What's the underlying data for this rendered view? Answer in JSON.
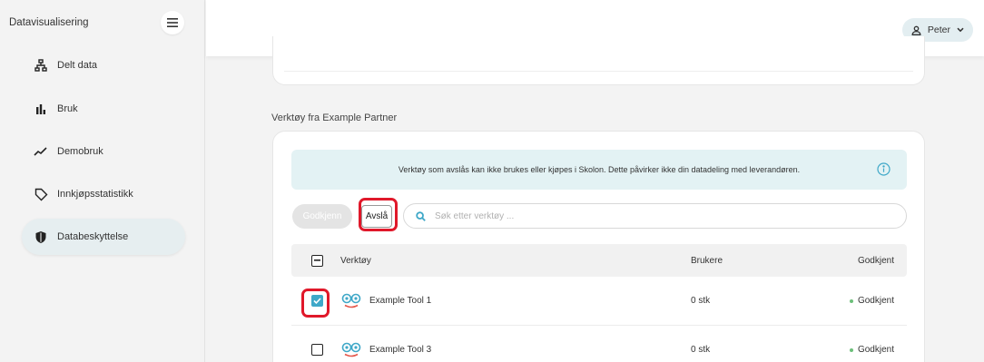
{
  "sidebar": {
    "title": "Datavisualisering",
    "items": [
      {
        "label": "Delt data",
        "icon": "sitemap-icon"
      },
      {
        "label": "Bruk",
        "icon": "bar-chart-icon"
      },
      {
        "label": "Demobruk",
        "icon": "trend-line-icon"
      },
      {
        "label": "Innkjøpsstatistikk",
        "icon": "tag-icon"
      },
      {
        "label": "Databeskyttelse",
        "icon": "shield-icon",
        "active": true
      }
    ]
  },
  "header": {
    "user_name": "Peter"
  },
  "section": {
    "title": "Verktøy fra Example Partner"
  },
  "info_banner": {
    "text": "Verktøy som avslås kan ikke brukes eller kjøpes i Skolon. Dette påvirker ikke din datadeling med leverandøren."
  },
  "actions": {
    "approve_label": "Godkjenn",
    "reject_label": "Avslå",
    "search_placeholder": "Søk etter verktøy ..."
  },
  "table": {
    "columns": {
      "tool": "Verktøy",
      "users": "Brukere",
      "approved": "Godkjent"
    },
    "rows": [
      {
        "name": "Example Tool 1",
        "users": "0 stk",
        "status": "Godkjent",
        "checked": true
      },
      {
        "name": "Example Tool 3",
        "users": "0 stk",
        "status": "Godkjent",
        "checked": false
      }
    ]
  },
  "colors": {
    "accent": "#3fa8c8",
    "highlight": "#e0182a",
    "status_ok": "#6cbf7a",
    "info_bg": "#e3f2f4"
  }
}
